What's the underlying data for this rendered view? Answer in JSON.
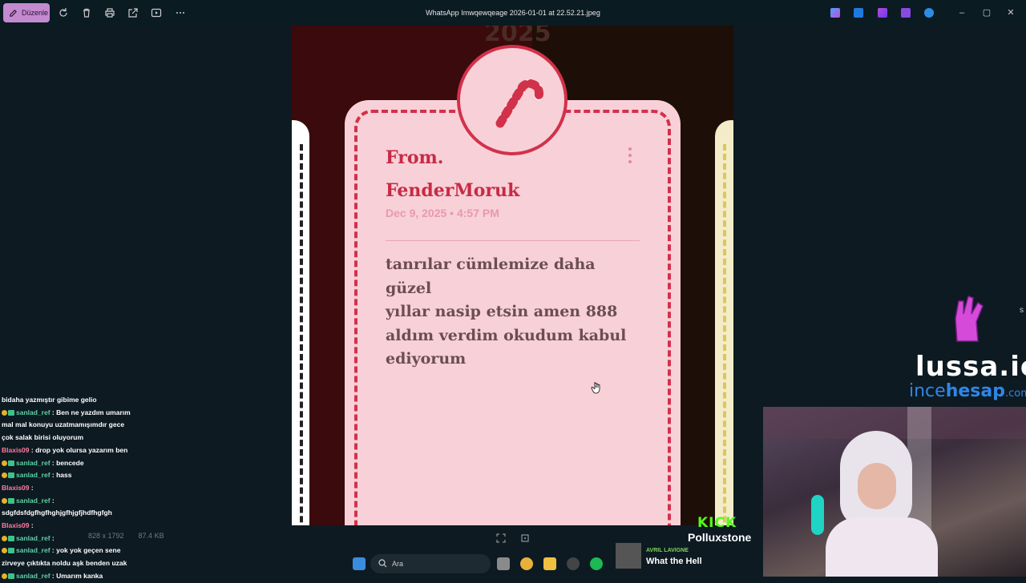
{
  "toolbar": {
    "edit_label": "Düzenle",
    "window_title": "WhatsApp Imwqewqeage 2026-01-01 at 22.52.21.jpeg"
  },
  "image": {
    "year": "2025",
    "from_label": "From.",
    "sender": "FenderMoruk",
    "date": "Dec 9, 2025 • 4:57 PM",
    "message_lines": [
      "tanrılar cümlemize daha güzel",
      "yıllar nasip etsin amen 888",
      "aldım verdim okudum kabul",
      "ediyorum"
    ]
  },
  "infobar": {
    "dimensions": "828 x 1792",
    "size": "87.4 KB"
  },
  "chat": [
    {
      "user": "",
      "text": "bidaha yazmıştır gibime gelio"
    },
    {
      "user": "sanlad_ref",
      "text": ": Ben ne yazdım umarım"
    },
    {
      "user": "",
      "text": "mal mal konuyu uzatmamışımdır gece"
    },
    {
      "user": "",
      "text": "çok salak birisi oluyorum"
    },
    {
      "user": "Blaxis09",
      "text": ": drop yok olursa yazarım ben"
    },
    {
      "user": "sanlad_ref",
      "text": ": bencede"
    },
    {
      "user": "sanlad_ref",
      "text": ": hass"
    },
    {
      "user": "Blaxis09",
      "text": ":"
    },
    {
      "user": "sanlad_ref",
      "text": ":"
    },
    {
      "user": "",
      "text": "sdgfdsfdgfhgfhghjgfhjgfjhdfhgfgh"
    },
    {
      "user": "Blaxis09",
      "text": ":"
    },
    {
      "user": "sanlad_ref",
      "text": ":"
    },
    {
      "user": "sanlad_ref",
      "text": ": yok yok geçen sene"
    },
    {
      "user": "",
      "text": "zirveye çıktıkta noldu aşk benden uzak"
    },
    {
      "user": "sanlad_ref",
      "text": ": Umarım kanka"
    }
  ],
  "overlay": {
    "brand": "lussa.io",
    "site_a": "ince",
    "site_b": "hesap",
    "site_c": ".com",
    "kick": "KICK",
    "streamer": "Polluxstone"
  },
  "taskbar": {
    "search_placeholder": "Ara"
  },
  "now_playing": {
    "artist": "AVRIL LAVIGNE",
    "song": "What the Hell"
  }
}
